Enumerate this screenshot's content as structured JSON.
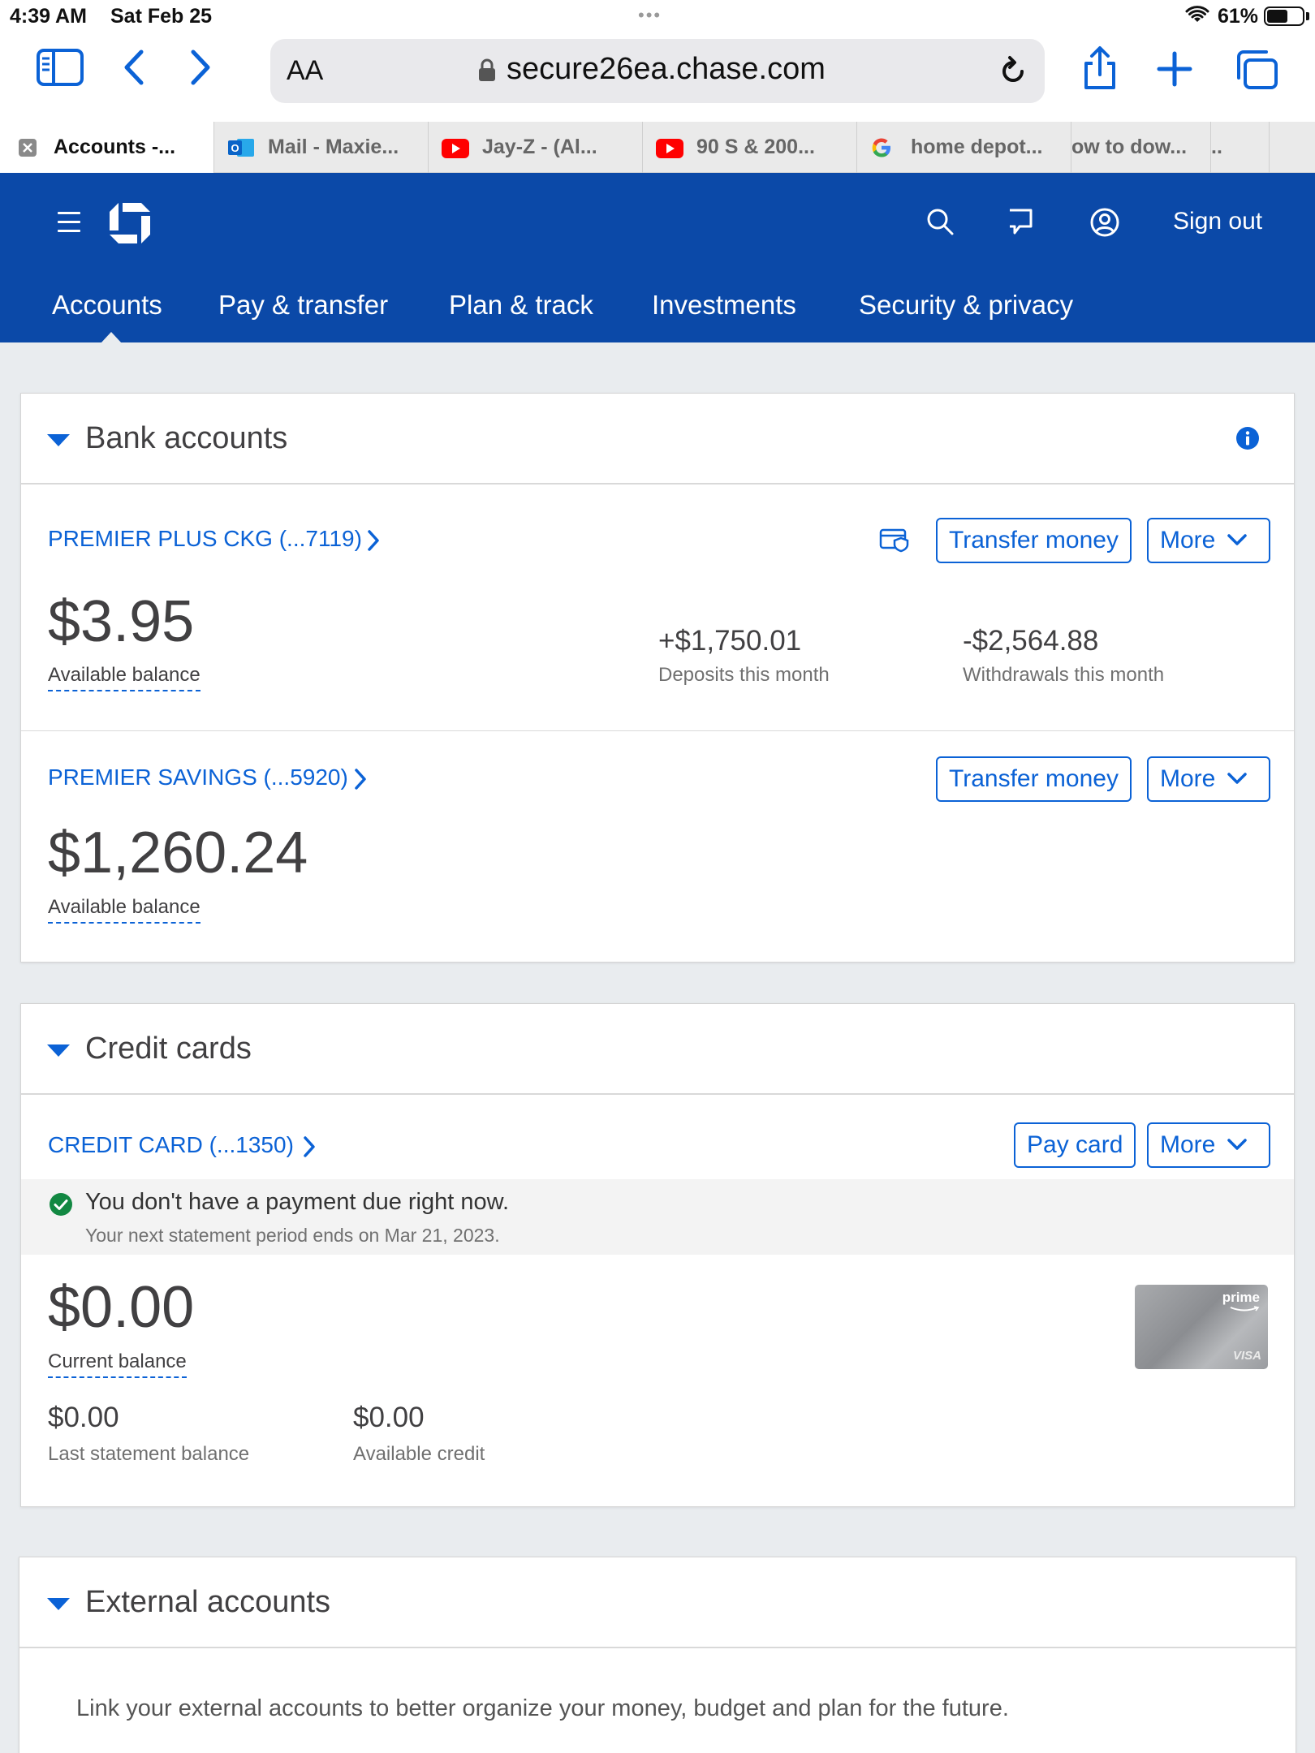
{
  "status_bar": {
    "time": "4:39 AM",
    "date": "Sat Feb 25",
    "battery": "61%",
    "battery_level": 0.61
  },
  "browser": {
    "aa_label": "AA",
    "url": "secure26ea.chase.com",
    "tabs": [
      {
        "label": "Accounts -...",
        "icon": "close-icon",
        "active": true
      },
      {
        "label": "Mail - Maxie...",
        "icon": "outlook-icon"
      },
      {
        "label": "Jay-Z - (Al...",
        "icon": "youtube-icon"
      },
      {
        "label": "90 S & 200...",
        "icon": "youtube-icon"
      },
      {
        "label": "home depot...",
        "icon": "google-icon"
      },
      {
        "label": "ow to dow...",
        "icon": ""
      },
      {
        "label": "..",
        "icon": ""
      }
    ]
  },
  "header": {
    "sign_out": "Sign out",
    "nav": [
      "Accounts",
      "Pay & transfer",
      "Plan & track",
      "Investments",
      "Security & privacy"
    ],
    "brand_color": "#0b49a8"
  },
  "bank_accounts": {
    "title": "Bank accounts",
    "accounts": [
      {
        "name": "PREMIER PLUS CKG (...7119)",
        "transfer_label": "Transfer money",
        "more_label": "More",
        "balance": "$3.95",
        "balance_label": "Available balance",
        "deposits": "+$1,750.01",
        "deposits_label": "Deposits this month",
        "withdrawals": "-$2,564.88",
        "withdrawals_label": "Withdrawals this month"
      },
      {
        "name": "PREMIER SAVINGS (...5920)",
        "transfer_label": "Transfer money",
        "more_label": "More",
        "balance": "$1,260.24",
        "balance_label": "Available balance"
      }
    ]
  },
  "credit_cards": {
    "title": "Credit cards",
    "card": {
      "name": "CREDIT CARD (...1350)",
      "pay_label": "Pay card",
      "more_label": "More",
      "notice_main": "You don't have a payment due right now.",
      "notice_sub": "Your next statement period ends on Mar 21, 2023.",
      "balance": "$0.00",
      "balance_label": "Current balance",
      "last_statement": "$0.00",
      "last_statement_label": "Last statement balance",
      "available_credit": "$0.00",
      "available_credit_label": "Available credit",
      "card_brand": "prime",
      "card_network": "VISA"
    }
  },
  "external_accounts": {
    "title": "External accounts",
    "description": "Link your external accounts to better organize your money, budget and plan for the future."
  }
}
